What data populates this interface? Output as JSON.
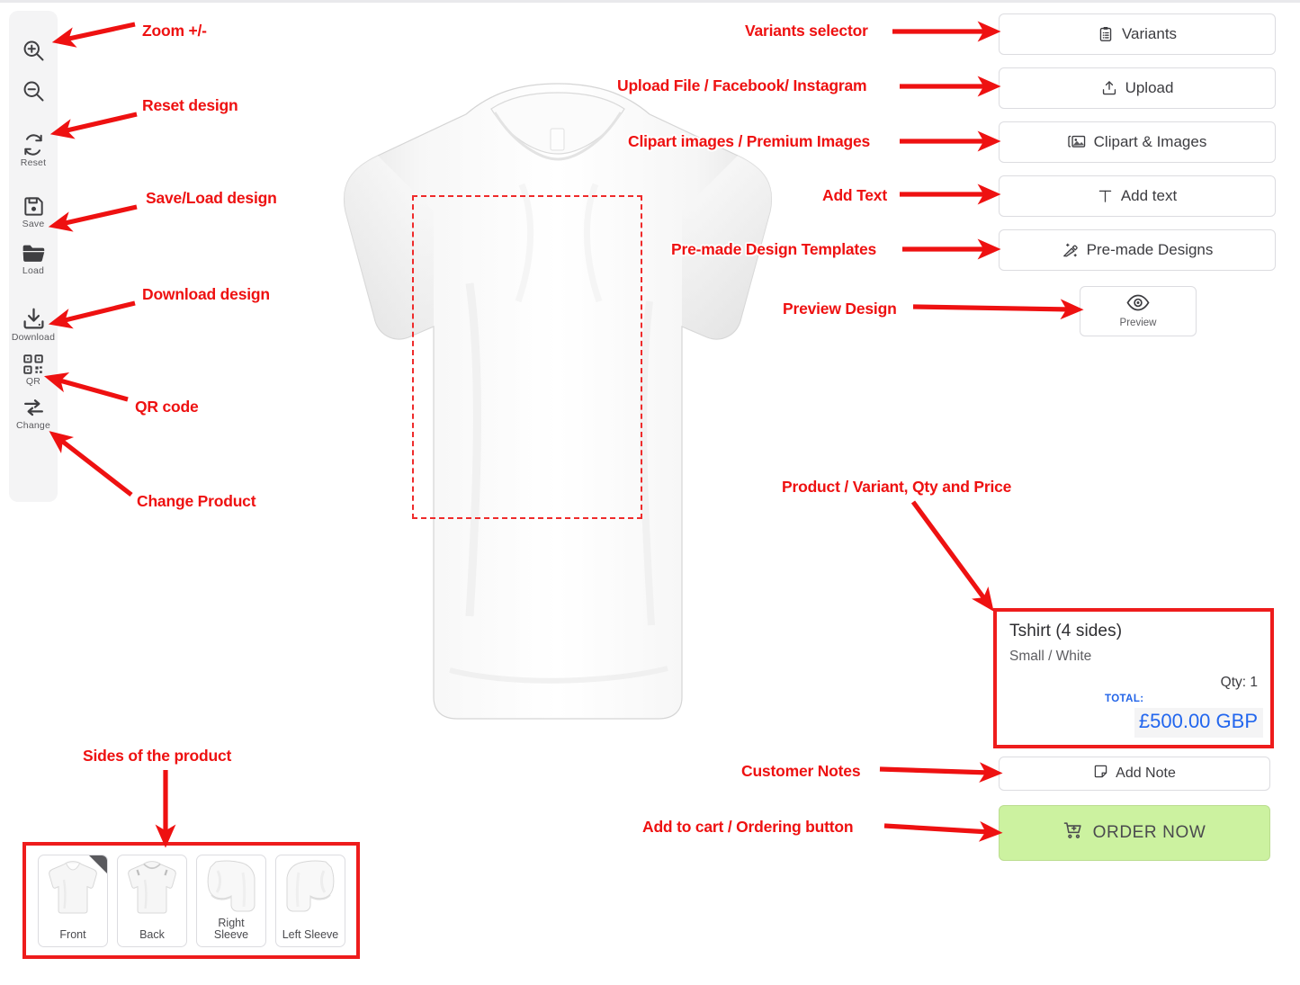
{
  "sidebar": {
    "tools": [
      {
        "id": "zoom-in",
        "icon": "zoom-in-icon",
        "label": ""
      },
      {
        "id": "zoom-out",
        "icon": "zoom-out-icon",
        "label": ""
      },
      {
        "id": "reset",
        "icon": "reset-icon",
        "label": "Reset"
      },
      {
        "id": "save",
        "icon": "save-icon",
        "label": "Save"
      },
      {
        "id": "load",
        "icon": "folder-icon",
        "label": "Load"
      },
      {
        "id": "download",
        "icon": "download-icon",
        "label": "Download"
      },
      {
        "id": "qr",
        "icon": "qr-code-icon",
        "label": "QR"
      },
      {
        "id": "change",
        "icon": "swap-icon",
        "label": "Change"
      }
    ]
  },
  "right_panel": {
    "buttons": [
      {
        "id": "variants",
        "label": "Variants",
        "icon": "clipboard-list-icon"
      },
      {
        "id": "upload",
        "label": "Upload",
        "icon": "upload-icon"
      },
      {
        "id": "clipart",
        "label": "Clipart & Images",
        "icon": "images-icon"
      },
      {
        "id": "addtext",
        "label": "Add text",
        "icon": "text-t-icon"
      },
      {
        "id": "premade",
        "label": "Pre-made Designs",
        "icon": "magic-wand-icon"
      }
    ],
    "preview": {
      "label": "Preview",
      "icon": "eye-icon"
    }
  },
  "product_card": {
    "title": "Tshirt (4 sides)",
    "variant": "Small / White",
    "qty": "Qty: 1",
    "total_label": "TOTAL:",
    "total_value": "£500.00 GBP",
    "border_color": "#ee1c1c",
    "price_color": "#2266ee"
  },
  "actions": {
    "add_note": {
      "label": "Add Note",
      "icon": "note-icon"
    },
    "order_now": {
      "label": "ORDER NOW",
      "icon": "cart-plus-icon",
      "background": "#ccf2a0"
    }
  },
  "sides": {
    "items": [
      {
        "label": "Front",
        "active": true
      },
      {
        "label": "Back",
        "active": false
      },
      {
        "label": "Right\nSleeve",
        "active": false
      },
      {
        "label": "Left Sleeve",
        "active": false
      }
    ]
  },
  "annotations": {
    "color": "#ee1111",
    "items": [
      {
        "id": "zoom",
        "text": "Zoom +/-"
      },
      {
        "id": "reset",
        "text": "Reset design"
      },
      {
        "id": "saveload",
        "text": "Save/Load design"
      },
      {
        "id": "download",
        "text": "Download design"
      },
      {
        "id": "qrcode",
        "text": "QR code"
      },
      {
        "id": "changeproduct",
        "text": "Change Product"
      },
      {
        "id": "variants",
        "text": "Variants selector"
      },
      {
        "id": "upload",
        "text": "Upload File / Facebook/ Instagram"
      },
      {
        "id": "clipart",
        "text": "Clipart images / Premium Images"
      },
      {
        "id": "addtext",
        "text": "Add Text"
      },
      {
        "id": "premade",
        "text": "Pre-made Design Templates"
      },
      {
        "id": "preview",
        "text": "Preview Design"
      },
      {
        "id": "productinfo",
        "text": "Product / Variant, Qty and Price"
      },
      {
        "id": "notes",
        "text": "Customer Notes"
      },
      {
        "id": "ordering",
        "text": "Add to cart / Ordering button"
      },
      {
        "id": "sides",
        "text": "Sides of the product"
      }
    ]
  }
}
